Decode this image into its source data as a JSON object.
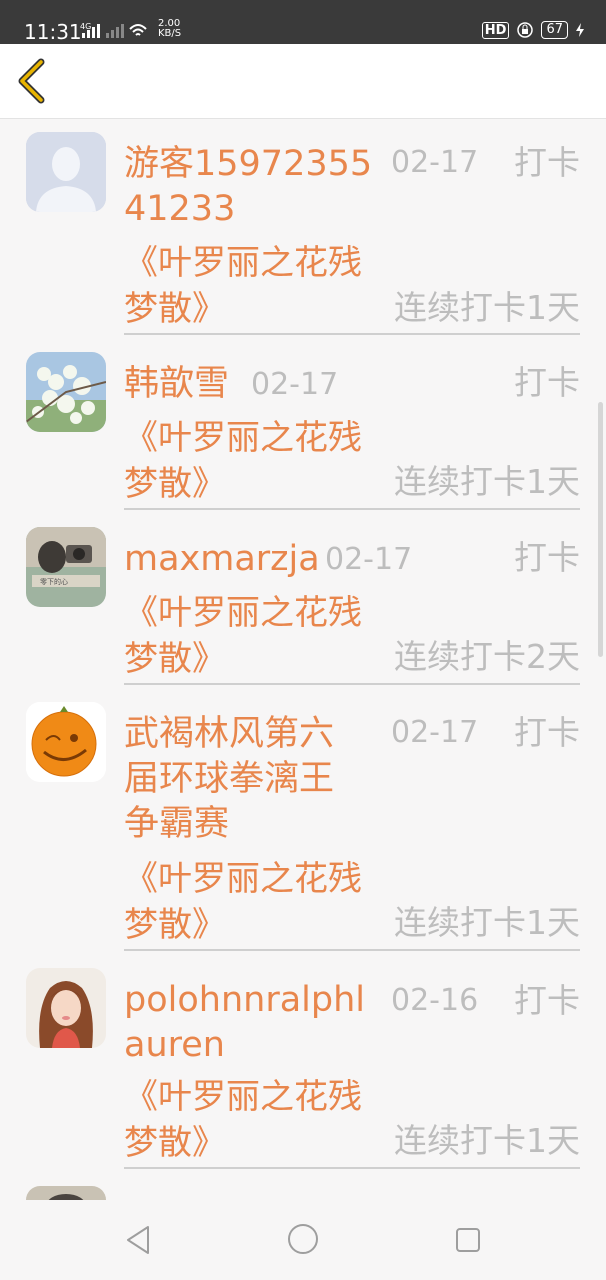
{
  "status_bar": {
    "time": "11:31",
    "network": "4G",
    "speed_value": "2.00",
    "speed_unit": "KB/S",
    "hd": "HD",
    "battery": "67"
  },
  "toolbar": {
    "back_icon": "chevron-left-icon",
    "accent": "#e8b400"
  },
  "list": {
    "items": [
      {
        "name": "游客1597235541233",
        "date": "02-17",
        "action": "打卡",
        "book": "《叶罗丽之花残梦散》",
        "streak": "连续打卡1天",
        "avatar": "default-user-avatar"
      },
      {
        "name": "韩歆雪",
        "date": "02-17",
        "action": "打卡",
        "book": "《叶罗丽之花残梦散》",
        "streak": "连续打卡1天",
        "avatar": "flower-blossom-avatar"
      },
      {
        "name": "maxmarzja",
        "date": "02-17",
        "action": "打卡",
        "book": "《叶罗丽之花残梦散》",
        "streak": "连续打卡2天",
        "avatar": "photo-avatar"
      },
      {
        "name": "武褐林风第六届环球拳漓王争霸赛",
        "date": "02-17",
        "action": "打卡",
        "book": "《叶罗丽之花残梦散》",
        "streak": "连续打卡1天",
        "avatar": "orange-face-avatar"
      },
      {
        "name": "polohnnralphlauren",
        "date": "02-16",
        "action": "打卡",
        "book": "《叶罗丽之花残梦散》",
        "streak": "连续打卡1天",
        "avatar": "girl-portrait-avatar"
      }
    ]
  },
  "colors": {
    "name": "#e8864c",
    "meta": "#bdbdbd",
    "divider": "#cfcfcf"
  },
  "nav_bar": {
    "back": "triangle-back-icon",
    "home": "circle-home-icon",
    "recent": "square-recent-icon"
  }
}
